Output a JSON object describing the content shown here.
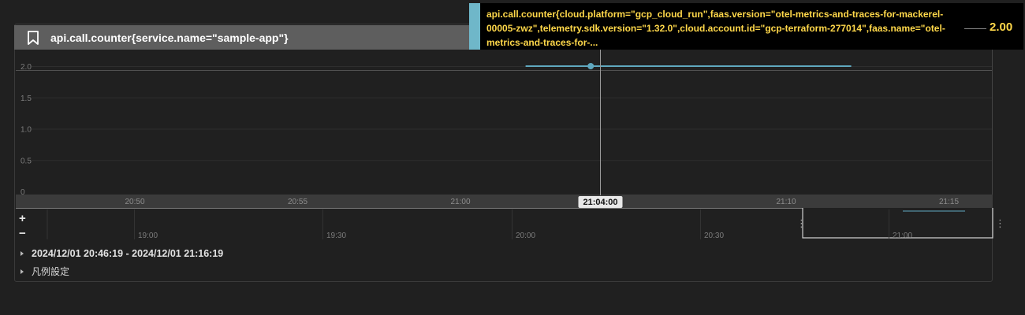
{
  "panel": {
    "title": "api.call.counter{service.name=\"sample-app\"}",
    "icon": "bookmark-icon"
  },
  "tooltip": {
    "series_text": "api.call.counter{cloud.platform=\"gcp_cloud_run\",faas.version=\"otel-metrics-and-traces-for-mackerel-00005-zwz\",telemetry.sdk.version=\"1.32.0\",cloud.account.id=\"gcp-terraform-277014\",faas.name=\"otel-metrics-and-traces-for-...",
    "value": "2.00",
    "swatch_color": "#6fb7c9",
    "text_color": "#ffd84a"
  },
  "chart_data": {
    "type": "line",
    "x": [
      "21:02",
      "21:04",
      "21:12"
    ],
    "series": [
      {
        "values": [
          2.0,
          2.0,
          2.0
        ],
        "color": "#5fa8bf"
      }
    ],
    "ylim": [
      0,
      2.2
    ],
    "yticks": [
      "0",
      "0.5",
      "1.0",
      "1.5",
      "2.0"
    ],
    "xticks": [
      "20:50",
      "20:55",
      "21:00",
      "21:10",
      "21:15"
    ],
    "grid": true,
    "crosshair_label": "21:04:00",
    "highlighted_x": "21:04",
    "highlighted_value": 2.0
  },
  "navigator": {
    "ticks": [
      "19:00",
      "19:30",
      "20:00",
      "20:30",
      "21:00"
    ],
    "zoom_in": "+",
    "zoom_out": "−"
  },
  "footer": {
    "range_label": "2024/12/01 20:46:19 - 2024/12/01 21:16:19",
    "legend_settings": "凡例設定"
  }
}
